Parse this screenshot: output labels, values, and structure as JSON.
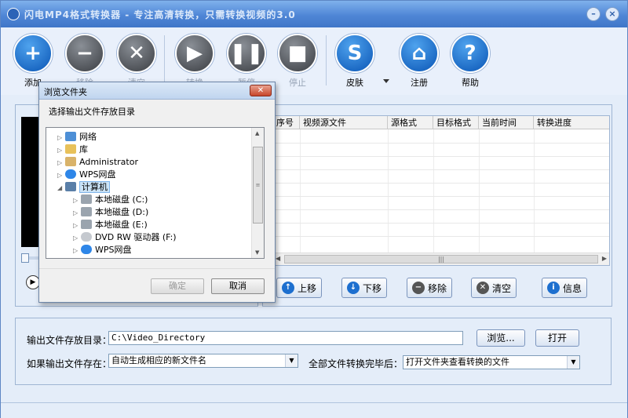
{
  "window": {
    "title": "闪电MP4格式转换器 - 专注高清转换，只需转换视频的3.0"
  },
  "toolbar": {
    "buttons": [
      {
        "label": "添加"
      },
      {
        "label": "移除"
      },
      {
        "label": "清空"
      },
      {
        "label": "转换"
      },
      {
        "label": "暂停"
      },
      {
        "label": "停止"
      },
      {
        "label": "皮肤"
      },
      {
        "label": "注册"
      },
      {
        "label": "帮助"
      }
    ]
  },
  "grid": {
    "columns": [
      "序号",
      "视频源文件",
      "源格式",
      "目标格式",
      "当前时间",
      "转换进度"
    ]
  },
  "actions": {
    "up": "上移",
    "down": "下移",
    "remove": "移除",
    "clear": "清空",
    "info": "信息"
  },
  "output": {
    "dir_label": "输出文件存放目录：",
    "dir_value": "C:\\Video_Directory",
    "browse": "浏览...",
    "open": "打开",
    "exists_label": "如果输出文件存在：",
    "exists_value": "自动生成相应的新文件名",
    "after_label": "全部文件转换完毕后：",
    "after_value": "打开文件夹查看转换的文件"
  },
  "dialog": {
    "title": "浏览文件夹",
    "prompt": "选择输出文件存放目录",
    "ok": "确定",
    "cancel": "取消",
    "tree": [
      {
        "label": "网络"
      },
      {
        "label": "库"
      },
      {
        "label": "Administrator"
      },
      {
        "label": "WPS网盘"
      },
      {
        "label": "计算机"
      },
      {
        "label": "本地磁盘 (C:)"
      },
      {
        "label": "本地磁盘 (D:)"
      },
      {
        "label": "本地磁盘 (E:)"
      },
      {
        "label": "DVD RW 驱动器 (F:)"
      },
      {
        "label": "WPS网盘"
      }
    ]
  },
  "colors": {
    "accent": "#0a55b5",
    "title_bar": "#4f86d6",
    "panel_bg": "#e4edf9"
  }
}
